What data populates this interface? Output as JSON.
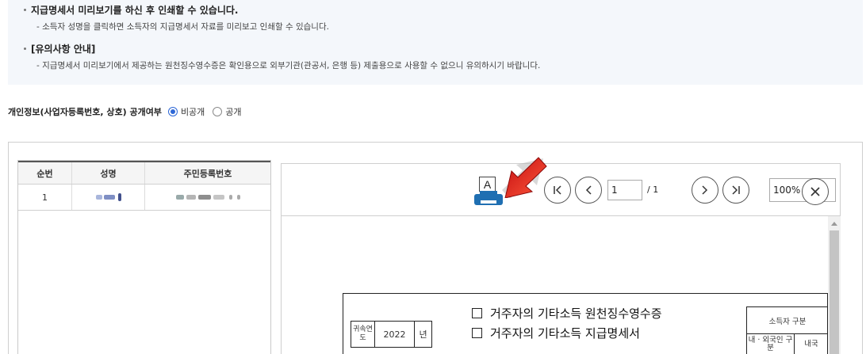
{
  "notice": {
    "line1": "지급명세서 미리보기를 하신 후 인쇄할 수 있습니다.",
    "line2": "- 소득자 성명을 클릭하면 소득자의 지급명세서 자료를 미리보고 인쇄할 수 있습니다.",
    "line3": "[유의사항 안내]",
    "line4": "- 지급명세서 미리보기에서 제공하는 원천징수영수증은 확인용으로 외부기관(관공서, 은행 등) 제출용으로 사용할 수 없으니 유의하시기 바랍니다."
  },
  "privacy": {
    "label": "개인정보(사업자등록번호, 상호) 공개여부",
    "options": [
      {
        "label": "비공개",
        "selected": true
      },
      {
        "label": "공개",
        "selected": false
      }
    ]
  },
  "table": {
    "headers": [
      "순번",
      "성명",
      "주민등록번호"
    ],
    "rows": [
      {
        "no": "1"
      }
    ]
  },
  "viewer": {
    "print_label": "A",
    "page_current": "1",
    "page_total": "/ 1",
    "zoom": "100%",
    "icons": [
      "printer-icon",
      "first-page-icon",
      "prev-page-icon",
      "next-page-icon",
      "last-page-icon",
      "close-icon",
      "red-arrow-icon"
    ]
  },
  "document": {
    "title1": "거주자의 기타소득 원천징수영수증",
    "title2": "거주자의 기타소득 지급명세서",
    "year_label": "귀속연도",
    "year_value": "2022",
    "year_unit": "년",
    "income_type": "소득자 구분",
    "resident_label": "내 · 외국인 구분",
    "resident_partial": "내국"
  },
  "colors": {
    "accent": "#2d67d6",
    "printer": "#1f6fb2",
    "arrow": "#e4191b",
    "notice_bg": "#f4f7fb"
  }
}
